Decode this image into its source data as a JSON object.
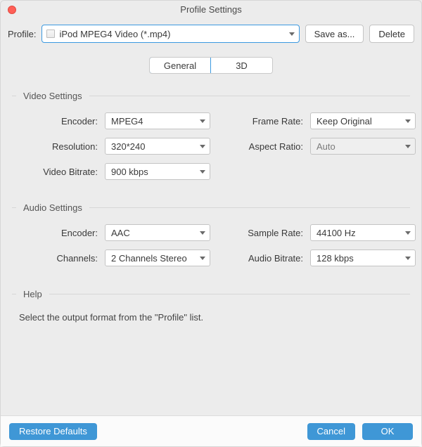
{
  "title": "Profile Settings",
  "toprow": {
    "profile_label": "Profile:",
    "profile_value": "iPod MPEG4 Video (*.mp4)",
    "saveas_label": "Save as...",
    "delete_label": "Delete"
  },
  "tabs": {
    "general": "General",
    "threedee": "3D"
  },
  "video": {
    "legend": "Video Settings",
    "encoder_label": "Encoder:",
    "encoder_value": "MPEG4",
    "framerate_label": "Frame Rate:",
    "framerate_value": "Keep Original",
    "resolution_label": "Resolution:",
    "resolution_value": "320*240",
    "aspect_label": "Aspect Ratio:",
    "aspect_value": "Auto",
    "bitrate_label": "Video Bitrate:",
    "bitrate_value": "900 kbps"
  },
  "audio": {
    "legend": "Audio Settings",
    "encoder_label": "Encoder:",
    "encoder_value": "AAC",
    "samplerate_label": "Sample Rate:",
    "samplerate_value": "44100 Hz",
    "channels_label": "Channels:",
    "channels_value": "2 Channels Stereo",
    "bitrate_label": "Audio Bitrate:",
    "bitrate_value": "128 kbps"
  },
  "help": {
    "legend": "Help",
    "text": "Select the output format from the \"Profile\" list."
  },
  "bottom": {
    "restore": "Restore Defaults",
    "cancel": "Cancel",
    "ok": "OK"
  }
}
